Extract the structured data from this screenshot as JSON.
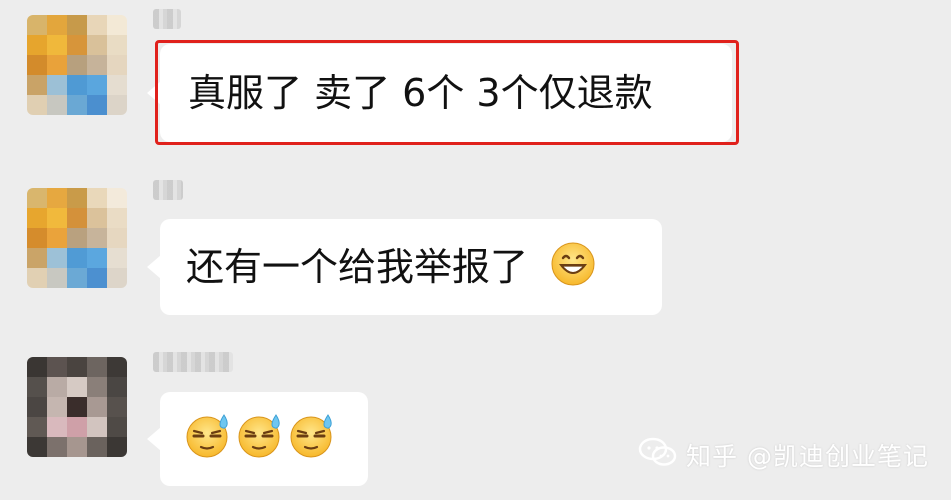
{
  "chat": {
    "messages": [
      {
        "text": "真服了 卖了 6个 3个仅退款",
        "highlighted": true
      },
      {
        "text": "还有一个给我举报了",
        "emoji": "grinning-face"
      },
      {
        "text": "",
        "emojis": [
          "sweat-smile-face",
          "sweat-smile-face",
          "sweat-smile-face"
        ]
      }
    ]
  },
  "watermark": {
    "text": "知乎 @凯迪创业笔记",
    "icon": "wechat-bubbles-icon"
  },
  "colors": {
    "background": "#ededed",
    "bubble": "#ffffff",
    "highlight_border": "#e0211c"
  }
}
